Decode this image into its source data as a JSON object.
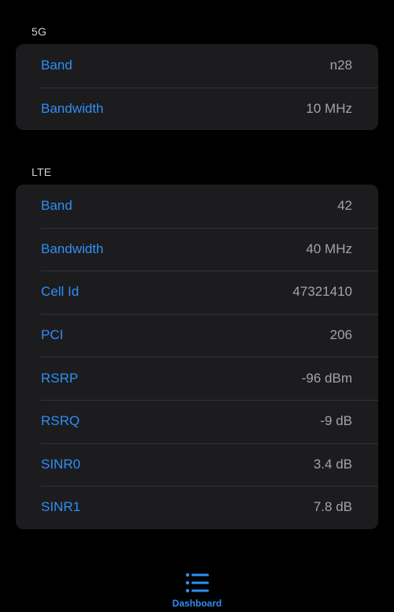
{
  "sections": {
    "fiveg": {
      "header": "5G",
      "rows": [
        {
          "label": "Band",
          "value": "n28"
        },
        {
          "label": "Bandwidth",
          "value": "10 MHz"
        }
      ]
    },
    "lte": {
      "header": "LTE",
      "rows": [
        {
          "label": "Band",
          "value": "42"
        },
        {
          "label": "Bandwidth",
          "value": "40 MHz"
        },
        {
          "label": "Cell Id",
          "value": "47321410"
        },
        {
          "label": "PCI",
          "value": "206"
        },
        {
          "label": "RSRP",
          "value": "-96 dBm"
        },
        {
          "label": "RSRQ",
          "value": "-9 dB"
        },
        {
          "label": "SINR0",
          "value": "3.4 dB"
        },
        {
          "label": "SINR1",
          "value": "7.8 dB"
        }
      ]
    }
  },
  "tabbar": {
    "items": [
      {
        "label": "Dashboard",
        "icon": "list-icon",
        "selected": true
      }
    ]
  },
  "colors": {
    "accent": "#2f8ef6",
    "background": "#000000",
    "card": "#1c1c1e",
    "value_text": "#a3a3a8"
  }
}
